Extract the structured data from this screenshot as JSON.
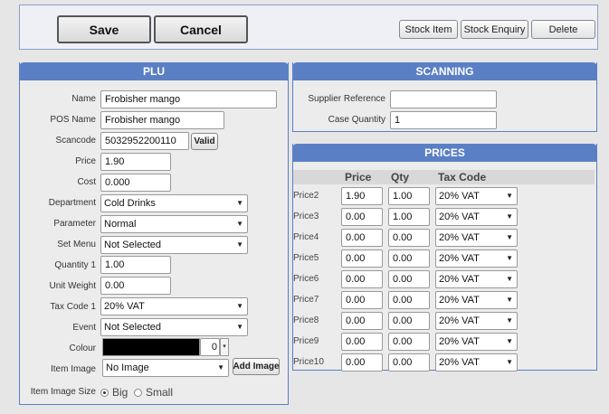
{
  "toolbar": {
    "save_label": "Save",
    "cancel_label": "Cancel",
    "stock_item_label": "Stock Item",
    "stock_enquiry_label": "Stock Enquiry",
    "delete_label": "Delete"
  },
  "plu": {
    "title": "PLU",
    "name_label": "Name",
    "name_value": "Frobisher mango",
    "pos_name_label": "POS Name",
    "pos_name_value": "Frobisher mango",
    "scancode_label": "Scancode",
    "scancode_value": "5032952200110",
    "valid_label": "Valid",
    "price_label": "Price",
    "price_value": "1.90",
    "cost_label": "Cost",
    "cost_value": "0.000",
    "department_label": "Department",
    "department_value": "Cold Drinks",
    "parameter_label": "Parameter",
    "parameter_value": "Normal",
    "set_menu_label": "Set Menu",
    "set_menu_value": "Not Selected",
    "quantity1_label": "Quantity 1",
    "quantity1_value": "1.00",
    "unit_weight_label": "Unit Weight",
    "unit_weight_value": "0.00",
    "tax_code1_label": "Tax Code 1",
    "tax_code1_value": "20% VAT",
    "event_label": "Event",
    "event_value": "Not Selected",
    "colour_label": "Colour",
    "colour_swatch": "#000000",
    "colour_value": "0",
    "item_image_label": "Item Image",
    "item_image_value": "No Image",
    "add_image_label": "Add Image",
    "image_size_label": "Item Image Size",
    "size_big": "Big",
    "size_small": "Small"
  },
  "scanning": {
    "title": "SCANNING",
    "supplier_ref_label": "Supplier Reference",
    "supplier_ref_value": "",
    "case_qty_label": "Case Quantity",
    "case_qty_value": "1"
  },
  "prices": {
    "title": "PRICES",
    "col_price": "Price",
    "col_qty": "Qty",
    "col_tax": "Tax Code",
    "rows": [
      {
        "label": "Price2",
        "price": "1.90",
        "qty": "1.00",
        "tax": "20% VAT"
      },
      {
        "label": "Price3",
        "price": "0.00",
        "qty": "1.00",
        "tax": "20% VAT"
      },
      {
        "label": "Price4",
        "price": "0.00",
        "qty": "0.00",
        "tax": "20% VAT"
      },
      {
        "label": "Price5",
        "price": "0.00",
        "qty": "0.00",
        "tax": "20% VAT"
      },
      {
        "label": "Price6",
        "price": "0.00",
        "qty": "0.00",
        "tax": "20% VAT"
      },
      {
        "label": "Price7",
        "price": "0.00",
        "qty": "0.00",
        "tax": "20% VAT"
      },
      {
        "label": "Price8",
        "price": "0.00",
        "qty": "0.00",
        "tax": "20% VAT"
      },
      {
        "label": "Price9",
        "price": "0.00",
        "qty": "0.00",
        "tax": "20% VAT"
      },
      {
        "label": "Price10",
        "price": "0.00",
        "qty": "0.00",
        "tax": "20% VAT"
      }
    ]
  }
}
